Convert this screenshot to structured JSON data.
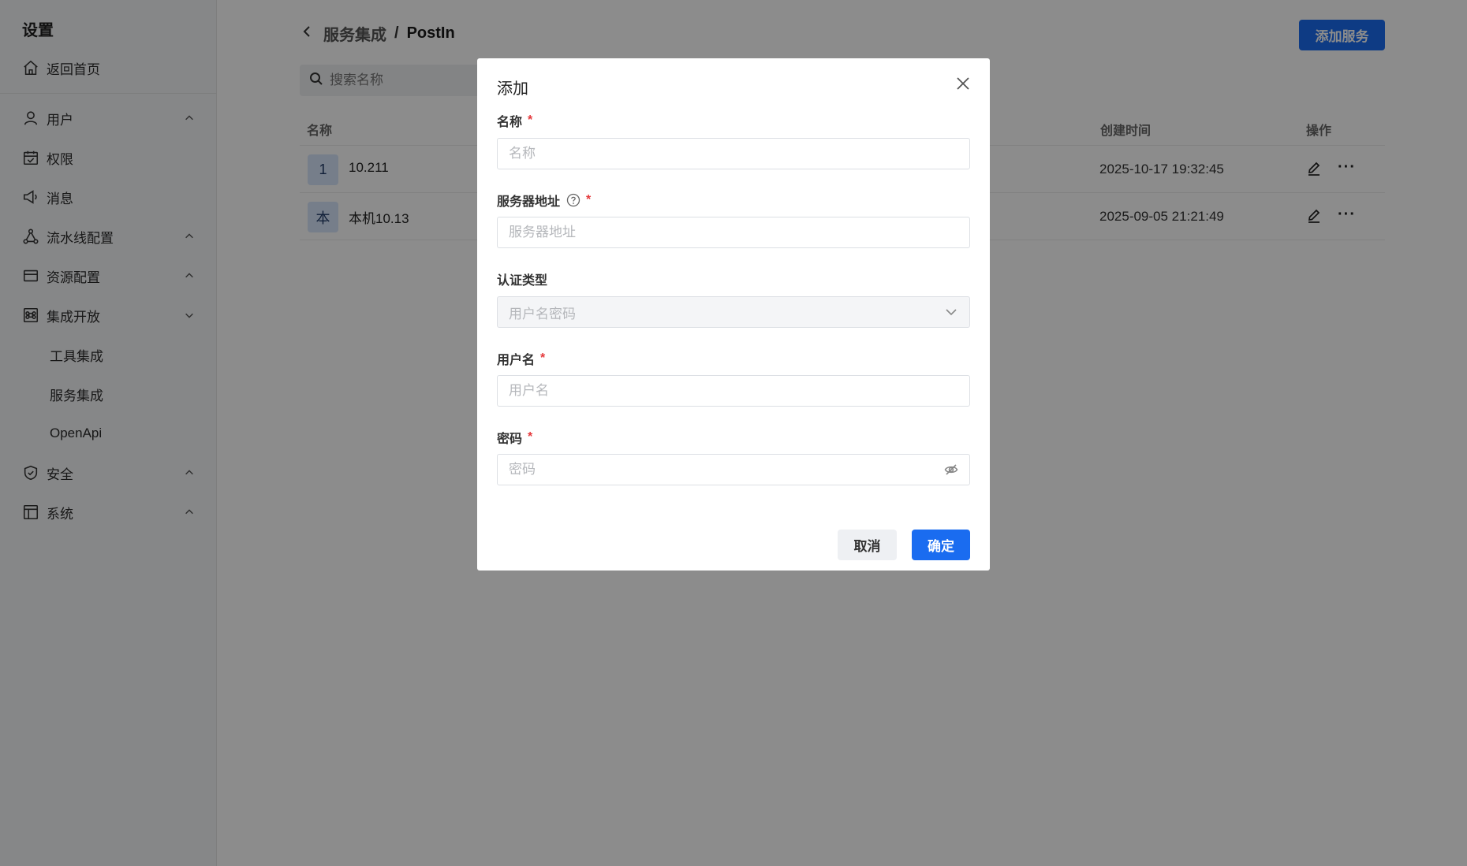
{
  "sidebar": {
    "title": "设置",
    "items": [
      {
        "label": "返回首页",
        "icon": "home-icon"
      },
      {
        "label": "用户",
        "icon": "user-icon",
        "chevron": "up"
      },
      {
        "label": "权限",
        "icon": "calendar-check-icon"
      },
      {
        "label": "消息",
        "icon": "megaphone-icon"
      },
      {
        "label": "流水线配置",
        "icon": "pipeline-icon",
        "chevron": "up"
      },
      {
        "label": "资源配置",
        "icon": "card-icon",
        "chevron": "up"
      },
      {
        "label": "集成开放",
        "icon": "command-icon",
        "chevron": "down"
      },
      {
        "label": "安全",
        "icon": "shield-check-icon",
        "chevron": "up"
      },
      {
        "label": "系统",
        "icon": "layout-icon",
        "chevron": "up"
      }
    ],
    "sub_items": [
      "工具集成",
      "服务集成",
      "OpenApi"
    ]
  },
  "header": {
    "crumb_parent": "服务集成",
    "separator": "/",
    "crumb_current": "PostIn",
    "add_button": "添加服务"
  },
  "search": {
    "placeholder": "搜索名称"
  },
  "table": {
    "columns": {
      "name": "名称",
      "created": "创建时间",
      "actions": "操作"
    },
    "rows": [
      {
        "avatar": "1",
        "name": "10.211",
        "created": "2025-10-17 19:32:45"
      },
      {
        "avatar": "本",
        "name": "本机10.13",
        "created": "2025-09-05 21:21:49"
      }
    ]
  },
  "modal": {
    "title": "添加",
    "fields": {
      "name": {
        "label": "名称",
        "placeholder": "名称",
        "required": "*"
      },
      "server": {
        "label": "服务器地址",
        "placeholder": "服务器地址",
        "required": "*"
      },
      "auth": {
        "label": "认证类型",
        "value": "用户名密码"
      },
      "username": {
        "label": "用户名",
        "placeholder": "用户名",
        "required": "*"
      },
      "password": {
        "label": "密码",
        "placeholder": "密码",
        "required": "*"
      }
    },
    "cancel": "取消",
    "confirm": "确定"
  },
  "colors": {
    "primary": "#1a6cf0",
    "required": "#e5383b"
  }
}
